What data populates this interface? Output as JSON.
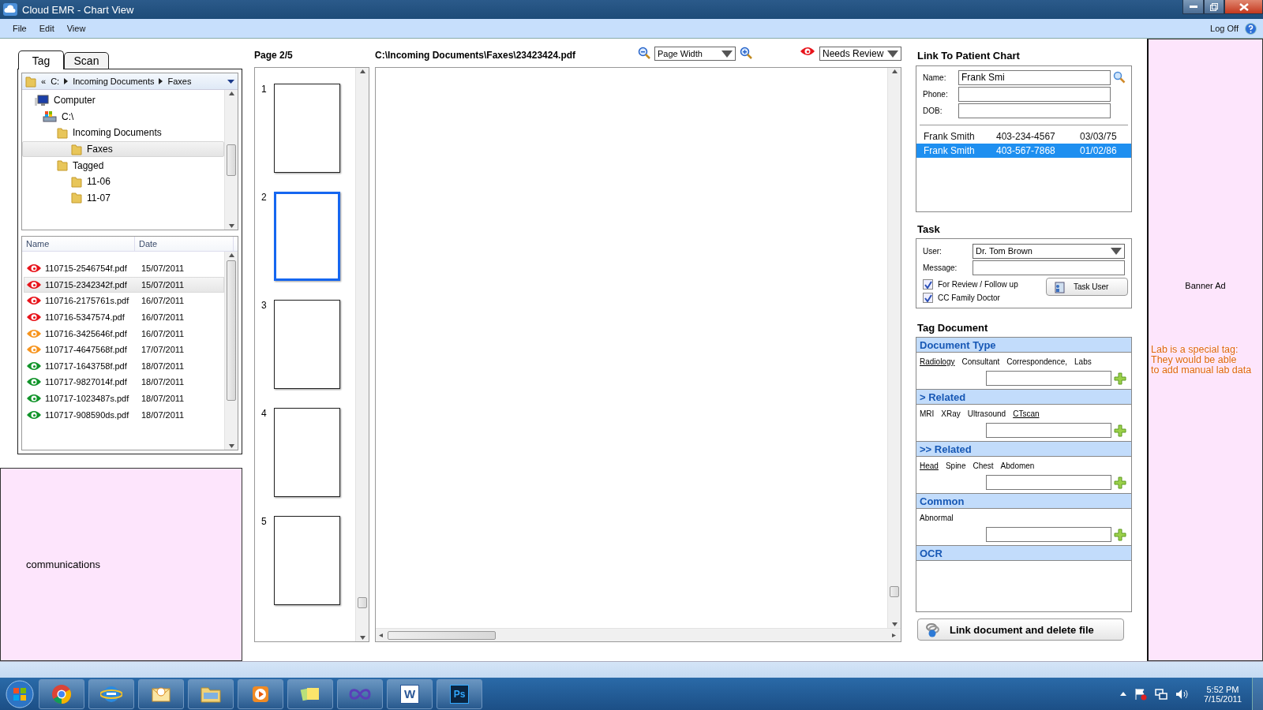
{
  "window": {
    "title": "Cloud EMR - Chart View"
  },
  "menu": [
    {
      "label": "File"
    },
    {
      "label": "Edit"
    },
    {
      "label": "View"
    }
  ],
  "log_off": "Log Off",
  "left_tabs": [
    {
      "label": "Tag",
      "selected": true
    },
    {
      "label": "Scan",
      "selected": false
    }
  ],
  "breadcrumb": {
    "overflow": "«",
    "parts": [
      "C:",
      "Incoming Documents",
      "Faxes"
    ]
  },
  "folder_tree": [
    {
      "label": "Computer",
      "kind": "computer",
      "selected": false,
      "children": [
        {
          "label": "C:\\",
          "kind": "drive",
          "selected": false,
          "children": [
            {
              "label": "Incoming Documents",
              "kind": "folder",
              "selected": false,
              "children": [
                {
                  "label": "Faxes",
                  "kind": "folder",
                  "selected": true
                }
              ]
            },
            {
              "label": "Tagged",
              "kind": "folder",
              "selected": false,
              "children": [
                {
                  "label": "11-06",
                  "kind": "folder",
                  "selected": false
                },
                {
                  "label": "11-07",
                  "kind": "folder",
                  "selected": false
                }
              ]
            }
          ]
        }
      ]
    }
  ],
  "file_list": {
    "columns": [
      "Name",
      "Date"
    ],
    "rows": [
      {
        "name": "110715-2546754f.pdf",
        "date": "15/07/2011",
        "color": "#e8141b",
        "selected": false
      },
      {
        "name": "110715-2342342f.pdf",
        "date": "15/07/2011",
        "color": "#e8141b",
        "selected": true
      },
      {
        "name": "110716-2175761s.pdf",
        "date": "16/07/2011",
        "color": "#e8141b",
        "selected": false
      },
      {
        "name": "110716-5347574.pdf",
        "date": "16/07/2011",
        "color": "#e8141b",
        "selected": false
      },
      {
        "name": "110716-3425646f.pdf",
        "date": "16/07/2011",
        "color": "#f7941d",
        "selected": false
      },
      {
        "name": "110717-4647568f.pdf",
        "date": "17/07/2011",
        "color": "#f7941d",
        "selected": false
      },
      {
        "name": "110717-1643758f.pdf",
        "date": "18/07/2011",
        "color": "#11942a",
        "selected": false
      },
      {
        "name": "110717-9827014f.pdf",
        "date": "18/07/2011",
        "color": "#11942a",
        "selected": false
      },
      {
        "name": "110717-1023487s.pdf",
        "date": "18/07/2011",
        "color": "#11942a",
        "selected": false
      },
      {
        "name": "110717-908590ds.pdf",
        "date": "18/07/2011",
        "color": "#11942a",
        "selected": false
      }
    ]
  },
  "communications": "communications",
  "thumbnails": {
    "page_label": "Page 2/5",
    "pages": [
      {
        "number": "1",
        "selected": false
      },
      {
        "number": "2",
        "selected": true
      },
      {
        "number": "3",
        "selected": false
      },
      {
        "number": "4",
        "selected": false
      },
      {
        "number": "5",
        "selected": false
      }
    ]
  },
  "viewer": {
    "path": "C:\\Incoming Documents\\Faxes\\23423424.pdf",
    "zoom": "Page Width",
    "status": "Needs Review"
  },
  "link_patient": {
    "title": "Link To Patient Chart",
    "fields": [
      {
        "label": "Name:",
        "value": "Frank Smi"
      },
      {
        "label": "Phone:"
      },
      {
        "label": "DOB:"
      }
    ],
    "results": [
      {
        "name": "Frank Smith",
        "phone": "403-234-4567",
        "dob": "03/03/75",
        "selected": false
      },
      {
        "name": "Frank Smith",
        "phone": "403-567-7868",
        "dob": "01/02/86",
        "selected": true
      }
    ]
  },
  "task": {
    "title": "Task",
    "user_label": "User:",
    "user": "Dr.  Tom Brown",
    "message_label": "Message:",
    "options": [
      {
        "label": "For Review / Follow up",
        "checked": true
      },
      {
        "label": "CC Family Doctor",
        "checked": true
      }
    ],
    "button": "Task User"
  },
  "tag_document": {
    "title": "Tag Document",
    "sections": [
      {
        "heading": "Document Type",
        "kind": "tags",
        "tags": [
          {
            "label": "Radiology",
            "selected": true
          },
          {
            "label": "Consultant",
            "selected": false
          },
          {
            "label": "Correspondence,",
            "selected": false
          },
          {
            "label": "Labs",
            "selected": false
          }
        ]
      },
      {
        "heading": "> Related",
        "kind": "tags",
        "tags": [
          {
            "label": "MRI",
            "selected": false
          },
          {
            "label": "XRay",
            "selected": false
          },
          {
            "label": "Ultrasound",
            "selected": false
          },
          {
            "label": "CTscan",
            "selected": true
          }
        ]
      },
      {
        "heading": ">> Related",
        "kind": "tags",
        "tags": [
          {
            "label": "Head",
            "selected": true
          },
          {
            "label": "Spine",
            "selected": false
          },
          {
            "label": "Chest",
            "selected": false
          },
          {
            "label": "Abdomen",
            "selected": false
          }
        ]
      },
      {
        "heading": "Common",
        "kind": "tags",
        "tags": [
          {
            "label": "Abnormal",
            "selected": false
          }
        ]
      },
      {
        "heading": "OCR",
        "kind": "text"
      }
    ]
  },
  "link_button": "Link document and delete file",
  "annotation": "Lab is a special tag:\nThey would be able\nto add manual lab data",
  "banner_ad": "Banner Ad",
  "taskbar": [
    {
      "kind": "chrome"
    },
    {
      "kind": "ie"
    },
    {
      "kind": "outlook"
    },
    {
      "kind": "explorer"
    },
    {
      "kind": "media"
    },
    {
      "kind": "notes"
    },
    {
      "kind": "infinity"
    },
    {
      "kind": "word",
      "label": "W"
    },
    {
      "kind": "photoshop",
      "label": "Ps"
    }
  ],
  "clock": {
    "time": "5:52 PM",
    "date": "7/15/2011"
  }
}
